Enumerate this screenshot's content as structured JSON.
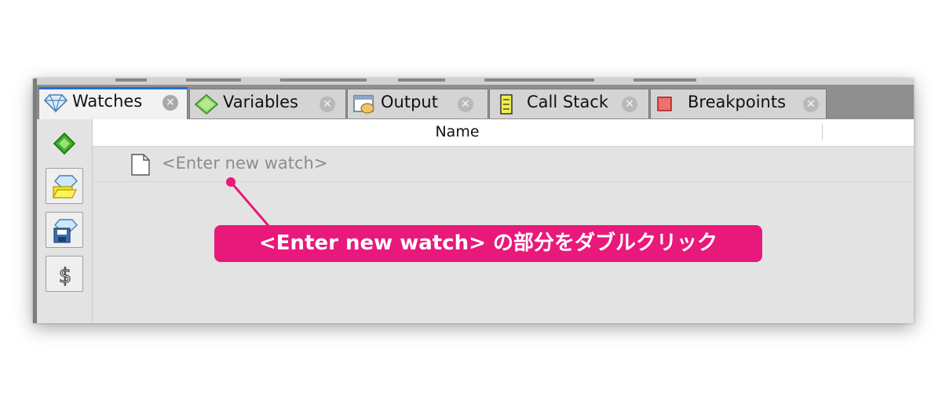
{
  "tabs": [
    {
      "label": "Watches",
      "icon": "watches-icon",
      "active": true
    },
    {
      "label": "Variables",
      "icon": "variables-icon",
      "active": false
    },
    {
      "label": "Output",
      "icon": "output-icon",
      "active": false
    },
    {
      "label": "Call Stack",
      "icon": "call-stack-icon",
      "active": false
    },
    {
      "label": "Breakpoints",
      "icon": "breakpoints-icon",
      "active": false
    }
  ],
  "tab_close_glyph": "✕",
  "toolbar": {
    "buttons": [
      "new-watch-icon",
      "open-watches-icon",
      "save-watches-icon",
      "dollar-icon"
    ],
    "dollar_glyph": "$"
  },
  "table": {
    "column_name": "Name",
    "placeholder_row": "<Enter new watch>"
  },
  "annotation": {
    "text": "<Enter new watch> の部分をダブルクリック",
    "color": "#e8197b"
  },
  "colors": {
    "active_tab_accent": "#1e6fe0",
    "panel_background": "#e3e3e3"
  }
}
